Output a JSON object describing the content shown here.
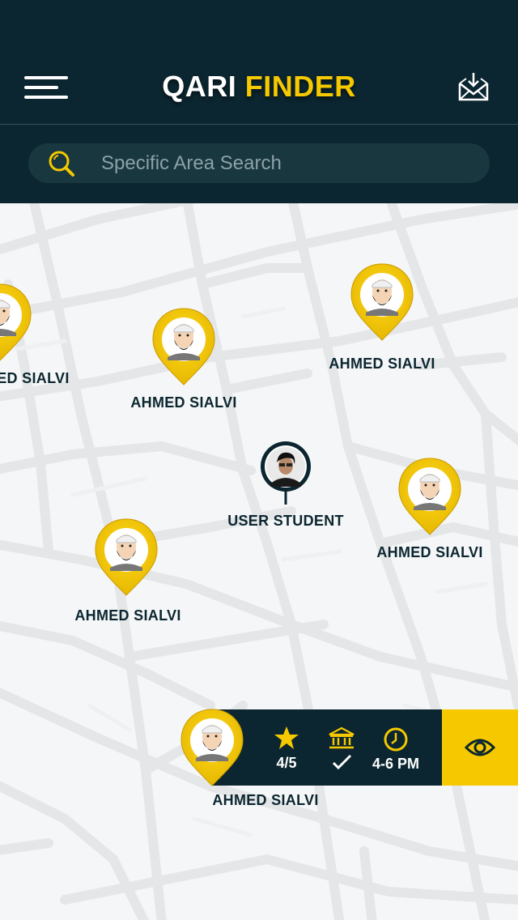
{
  "header": {
    "title_part1": "QARI",
    "title_part2": "FINDER",
    "menu_icon": "hamburger-menu-icon",
    "inbox_icon": "inbox-mail-icon"
  },
  "search": {
    "placeholder": "Specific Area Search",
    "icon": "search-icon"
  },
  "colors": {
    "primary_dark": "#0b2630",
    "accent_yellow": "#f5c800"
  },
  "map": {
    "qari_markers": [
      {
        "label": "AHMED SIALVI"
      },
      {
        "label": "AHMED SIALVI"
      },
      {
        "label": "AHMED SIALVI"
      },
      {
        "label": "AHMED SIALVI"
      },
      {
        "label": "AHMED SIALVI"
      },
      {
        "label": "AHMED SIALVI"
      }
    ],
    "user_marker": {
      "label": "USER STUDENT"
    }
  },
  "selected_qari": {
    "name": "AHMED SIALVI",
    "rating": "4/5",
    "rating_icon": "star-icon",
    "verified_icon": "institution-check-icon",
    "time": "4-6 PM",
    "time_icon": "clock-icon",
    "view_icon": "eye-icon"
  }
}
